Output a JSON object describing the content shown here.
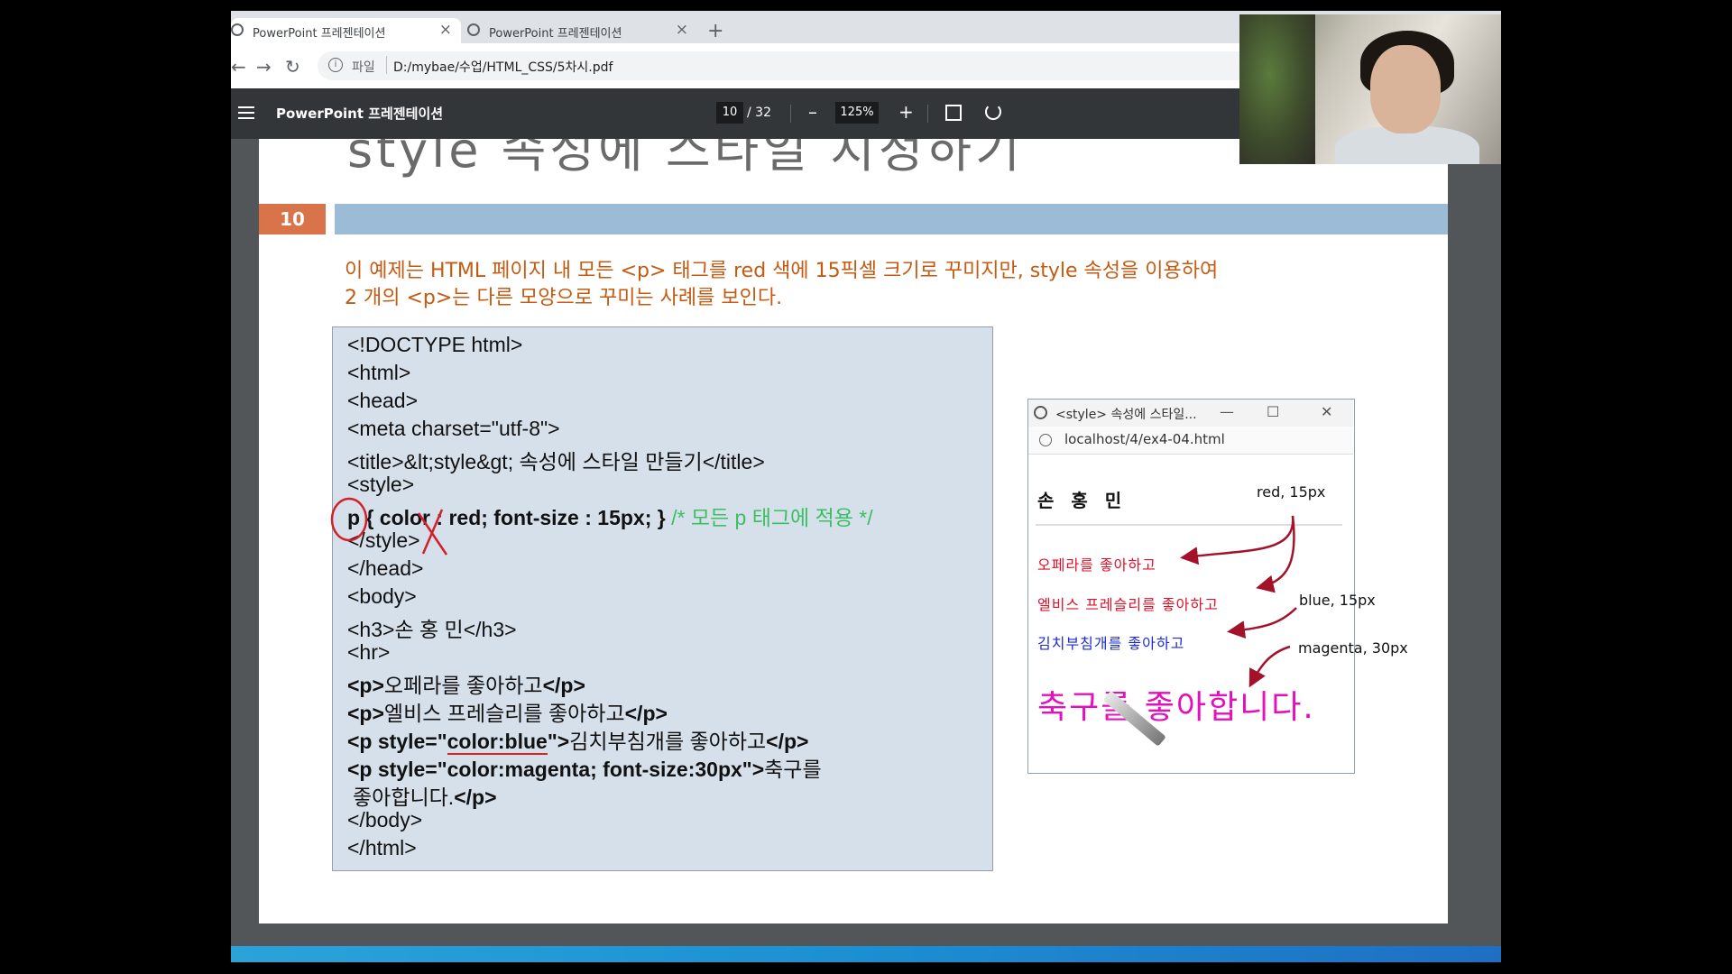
{
  "browser": {
    "tabs": [
      {
        "label": "PowerPoint 프레젠테이션",
        "active": true
      },
      {
        "label": "PowerPoint 프레젠테이션",
        "active": false
      }
    ],
    "new_tab": "+",
    "close_glyph": "×",
    "address": {
      "scheme": "파일",
      "url": "D:/mybae/수업/HTML_CSS/5차시.pdf"
    }
  },
  "pdf_viewer": {
    "title": "PowerPoint 프레젠테이션",
    "page_current": "10",
    "page_total": "/ 32",
    "zoom": "125%",
    "zoom_out": "–",
    "zoom_in": "+"
  },
  "slide": {
    "title_fragment": "style 속성에 스타일 지정하기",
    "page_number": "10",
    "description": [
      "이 예제는 HTML 페이지 내 모든 <p> 태그를 red 색에 15픽셀 크기로 꾸미지만, style 속성을 이용하여",
      "2 개의 <p>는 다른 모양으로 꾸미는 사례를 보인다."
    ],
    "code": {
      "l1": "<!DOCTYPE html>",
      "l2": "<html>",
      "l3": "<head>",
      "l4": "<meta charset=\"utf-8\">",
      "l5": "<title>&lt;style&gt; 속성에 스타일 만들기</title>",
      "l6": "<style>",
      "l7_code": "p { color : red; font-size : 15px; }",
      "l7_comment": " /* 모든 p 태그에 적용 */",
      "l8": "</style>",
      "l9": "</head>",
      "l10": "<body>",
      "l11": "<h3>손 홍 민</h3>",
      "l12": "<hr>",
      "l13_open": "<p>",
      "l13_text": "오페라를 좋아하고",
      "l13_close": "</p>",
      "l14_open": "<p>",
      "l14_text": "엘비스 프레슬리를 좋아하고",
      "l14_close": "</p>",
      "l15_open": "<p style=\"",
      "l15_style": "color:blue",
      "l15_mid": "\">",
      "l15_text": "김치부침개를 좋아하고",
      "l15_close": "</p>",
      "l16_open": "<p style=\"color:magenta; font-size:30px\">",
      "l16_text": "축구를",
      "l17_text": "좋아합니다.",
      "l17_close": "</p>",
      "l18": "</body>",
      "l19": "</html>"
    },
    "preview": {
      "window_title": "<style> 속성에 스타일...",
      "min": "—",
      "max": "☐",
      "close": "✕",
      "url": "localhost/4/ex4-04.html",
      "heading": "손 홍 민",
      "p1": "오페라를 좋아하고",
      "p2": "엘비스 프레슬리를 좋아하고",
      "p3": "김치부침개를 좋아하고",
      "p4": "축구를 좋아합니다.",
      "colors": {
        "red": "#e0102a",
        "blue": "#1a2bd8",
        "magenta": "#e60fbd"
      }
    },
    "annotations": {
      "a1": "red, 15px",
      "a2": "blue, 15px",
      "a3": "magenta, 30px"
    }
  },
  "icons": [
    "globe-icon",
    "back-arrow-icon",
    "forward-arrow-icon",
    "reload-icon",
    "info-icon",
    "menu-icon",
    "fit-page-icon",
    "rotate-icon",
    "pen-cursor-icon"
  ]
}
